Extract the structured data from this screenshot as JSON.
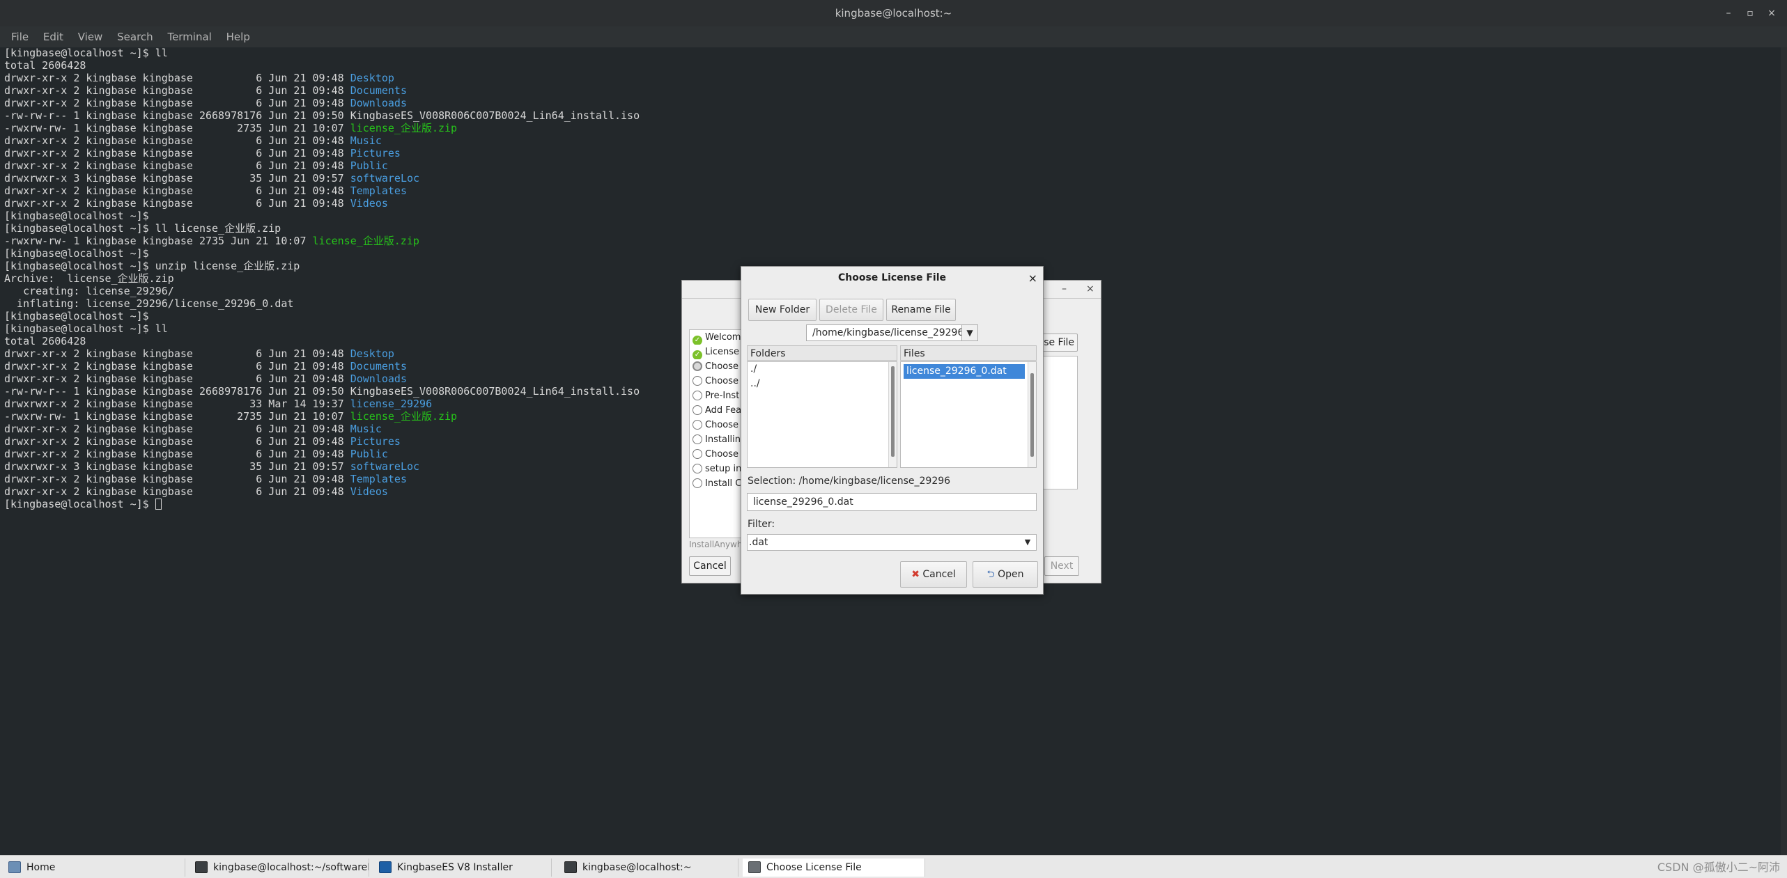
{
  "window": {
    "title": "kingbase@localhost:~",
    "controls": {
      "minimize": "–",
      "maximize": "▫",
      "close": "×"
    }
  },
  "menubar": [
    "File",
    "Edit",
    "View",
    "Search",
    "Terminal",
    "Help"
  ],
  "terminal": {
    "lines": [
      [
        {
          "t": "[kingbase@localhost ~]$ ll"
        }
      ],
      [
        {
          "t": "total 2606428"
        }
      ],
      [
        {
          "t": "drwxr-xr-x 2 kingbase kingbase          6 Jun 21 09:48 "
        },
        {
          "t": "Desktop",
          "c": "blue"
        }
      ],
      [
        {
          "t": "drwxr-xr-x 2 kingbase kingbase          6 Jun 21 09:48 "
        },
        {
          "t": "Documents",
          "c": "blue"
        }
      ],
      [
        {
          "t": "drwxr-xr-x 2 kingbase kingbase          6 Jun 21 09:48 "
        },
        {
          "t": "Downloads",
          "c": "blue"
        }
      ],
      [
        {
          "t": "-rw-rw-r-- 1 kingbase kingbase 2668978176 Jun 21 09:50 KingbaseES_V008R006C007B0024_Lin64_install.iso"
        }
      ],
      [
        {
          "t": "-rwxrw-rw- 1 kingbase kingbase       2735 Jun 21 10:07 "
        },
        {
          "t": "license_企业版.zip",
          "c": "green"
        }
      ],
      [
        {
          "t": "drwxr-xr-x 2 kingbase kingbase          6 Jun 21 09:48 "
        },
        {
          "t": "Music",
          "c": "blue"
        }
      ],
      [
        {
          "t": "drwxr-xr-x 2 kingbase kingbase          6 Jun 21 09:48 "
        },
        {
          "t": "Pictures",
          "c": "blue"
        }
      ],
      [
        {
          "t": "drwxr-xr-x 2 kingbase kingbase          6 Jun 21 09:48 "
        },
        {
          "t": "Public",
          "c": "blue"
        }
      ],
      [
        {
          "t": "drwxrwxr-x 3 kingbase kingbase         35 Jun 21 09:57 "
        },
        {
          "t": "softwareLoc",
          "c": "blue"
        }
      ],
      [
        {
          "t": "drwxr-xr-x 2 kingbase kingbase          6 Jun 21 09:48 "
        },
        {
          "t": "Templates",
          "c": "blue"
        }
      ],
      [
        {
          "t": "drwxr-xr-x 2 kingbase kingbase          6 Jun 21 09:48 "
        },
        {
          "t": "Videos",
          "c": "blue"
        }
      ],
      [
        {
          "t": "[kingbase@localhost ~]$"
        }
      ],
      [
        {
          "t": "[kingbase@localhost ~]$ ll license_企业版.zip"
        }
      ],
      [
        {
          "t": "-rwxrw-rw- 1 kingbase kingbase 2735 Jun 21 10:07 "
        },
        {
          "t": "license_企业版.zip",
          "c": "green"
        }
      ],
      [
        {
          "t": "[kingbase@localhost ~]$"
        }
      ],
      [
        {
          "t": "[kingbase@localhost ~]$ unzip license_企业版.zip"
        }
      ],
      [
        {
          "t": "Archive:  license_企业版.zip"
        }
      ],
      [
        {
          "t": "   creating: license_29296/"
        }
      ],
      [
        {
          "t": "  inflating: license_29296/license_29296_0.dat"
        }
      ],
      [
        {
          "t": "[kingbase@localhost ~]$"
        }
      ],
      [
        {
          "t": "[kingbase@localhost ~]$ ll"
        }
      ],
      [
        {
          "t": "total 2606428"
        }
      ],
      [
        {
          "t": "drwxr-xr-x 2 kingbase kingbase          6 Jun 21 09:48 "
        },
        {
          "t": "Desktop",
          "c": "blue"
        }
      ],
      [
        {
          "t": "drwxr-xr-x 2 kingbase kingbase          6 Jun 21 09:48 "
        },
        {
          "t": "Documents",
          "c": "blue"
        }
      ],
      [
        {
          "t": "drwxr-xr-x 2 kingbase kingbase          6 Jun 21 09:48 "
        },
        {
          "t": "Downloads",
          "c": "blue"
        }
      ],
      [
        {
          "t": "-rw-rw-r-- 1 kingbase kingbase 2668978176 Jun 21 09:50 KingbaseES_V008R006C007B0024_Lin64_install.iso"
        }
      ],
      [
        {
          "t": "drwxrwxr-x 2 kingbase kingbase         33 Mar 14 19:37 "
        },
        {
          "t": "license_29296",
          "c": "blue"
        }
      ],
      [
        {
          "t": "-rwxrw-rw- 1 kingbase kingbase       2735 Jun 21 10:07 "
        },
        {
          "t": "license_企业版.zip",
          "c": "green"
        }
      ],
      [
        {
          "t": "drwxr-xr-x 2 kingbase kingbase          6 Jun 21 09:48 "
        },
        {
          "t": "Music",
          "c": "blue"
        }
      ],
      [
        {
          "t": "drwxr-xr-x 2 kingbase kingbase          6 Jun 21 09:48 "
        },
        {
          "t": "Pictures",
          "c": "blue"
        }
      ],
      [
        {
          "t": "drwxr-xr-x 2 kingbase kingbase          6 Jun 21 09:48 "
        },
        {
          "t": "Public",
          "c": "blue"
        }
      ],
      [
        {
          "t": "drwxrwxr-x 3 kingbase kingbase         35 Jun 21 09:57 "
        },
        {
          "t": "softwareLoc",
          "c": "blue"
        }
      ],
      [
        {
          "t": "drwxr-xr-x 2 kingbase kingbase          6 Jun 21 09:48 "
        },
        {
          "t": "Templates",
          "c": "blue"
        }
      ],
      [
        {
          "t": "drwxr-xr-x 2 kingbase kingbase          6 Jun 21 09:48 "
        },
        {
          "t": "Videos",
          "c": "blue"
        }
      ],
      [
        {
          "t": "[kingbase@localhost ~]$ "
        }
      ]
    ],
    "colors": {
      "blue": "#4a9ee0",
      "green": "#26c21a",
      "text": "#d7d7d7",
      "background": "#23282b"
    }
  },
  "installer": {
    "controls": {
      "minimize": "–",
      "close": "×"
    },
    "steps": [
      {
        "label": "Welcome",
        "state": "done"
      },
      {
        "label": "License",
        "state": "done"
      },
      {
        "label": "Choose",
        "state": "current"
      },
      {
        "label": "Choose",
        "state": "todo"
      },
      {
        "label": "Pre-Inst",
        "state": "todo"
      },
      {
        "label": "Add Fea",
        "state": "todo"
      },
      {
        "label": "Choose",
        "state": "todo"
      },
      {
        "label": "Installin",
        "state": "todo"
      },
      {
        "label": "Choose",
        "state": "todo"
      },
      {
        "label": "setup in",
        "state": "todo"
      },
      {
        "label": "Install C",
        "state": "todo"
      }
    ],
    "footer_label": "InstallAnywh",
    "cancel_label": "Cancel",
    "next_label": "Next",
    "license_file_button_label": "nse File"
  },
  "dialog": {
    "title": "Choose License File",
    "close_icon": "×",
    "toolbar": {
      "new_folder": "New Folder",
      "delete_file": "Delete File",
      "rename_file": "Rename File"
    },
    "path": "/home/kingbase/license_29296",
    "folders_header": "Folders",
    "files_header": "Files",
    "folders": [
      "./",
      "../"
    ],
    "files": [
      "license_29296_0.dat"
    ],
    "selection_label": "Selection: /home/kingbase/license_29296",
    "selection_value": "license_29296_0.dat",
    "filter_label": "Filter:",
    "filter_value": ".dat",
    "cancel_label": "Cancel",
    "open_label": "Open"
  },
  "taskbar": {
    "tasks": [
      {
        "label": "Home",
        "icon": "home-icon"
      },
      {
        "label": "kingbase@localhost:~/softwareLoc/...",
        "icon": "terminal-icon"
      },
      {
        "label": "KingbaseES V8 Installer",
        "icon": "installer-icon"
      },
      {
        "label": "kingbase@localhost:~",
        "icon": "terminal-icon"
      },
      {
        "label": "Choose License File",
        "icon": "dialog-icon",
        "active": true
      }
    ],
    "watermark": "CSDN @孤傲小二~阿沛"
  }
}
